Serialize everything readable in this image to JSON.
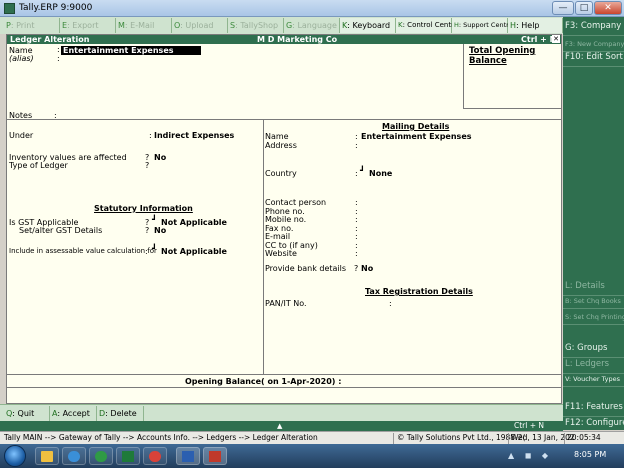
{
  "window": {
    "title": "Tally.ERP 9:9000",
    "minimize": "—",
    "maximize": "□",
    "close": "✕"
  },
  "topbar": [
    {
      "key": "P",
      "label": ": Print",
      "active": false
    },
    {
      "key": "E",
      "label": ": Export",
      "active": false
    },
    {
      "key": "M",
      "label": ": E-Mail",
      "active": false
    },
    {
      "key": "O",
      "label": ": Upload",
      "active": false
    },
    {
      "key": "S",
      "label": ": TallyShop",
      "active": false
    },
    {
      "key": "G",
      "label": ": Language",
      "active": false
    },
    {
      "key": "K",
      "label": ": Keyboard",
      "active": true
    },
    {
      "key": "K",
      "label": ": Control Centre",
      "active": true
    },
    {
      "key": "H",
      "label": ": Support Centre",
      "active": true
    },
    {
      "key": "H",
      "label": ": Help",
      "active": true
    }
  ],
  "rightpanel": [
    {
      "label": "F3: Company",
      "dim": false
    },
    {
      "label": "F3: New Company",
      "dim": true
    },
    {
      "label": "F10: Edit Sort",
      "dim": false
    },
    {
      "label": "L: Details",
      "dim": true
    },
    {
      "label": "B: Set Chq Books",
      "dim": true
    },
    {
      "label": "S: Set Chq Printing",
      "dim": true
    },
    {
      "label": "G: Groups",
      "dim": false
    },
    {
      "label": "L: Ledgers",
      "dim": true
    },
    {
      "label": "V: Voucher Types",
      "dim": false
    },
    {
      "label": "F11: Features",
      "dim": false
    },
    {
      "label": "F12: Configure",
      "dim": false
    }
  ],
  "header": {
    "title": "Ledger Alteration",
    "company": "M D Marketing Co",
    "shortcut": "Ctrl + M",
    "close": "✕"
  },
  "form": {
    "name_label": "Name",
    "name_value": "Entertainment Expenses",
    "alias_label": "(alias)",
    "colon": ":",
    "opening_balance_box": "Total Opening Balance",
    "notes_label": "Notes",
    "under_label": "Under",
    "under_value": "Indirect Expenses",
    "inventory_label": "Inventory values are affected",
    "inventory_value": "No",
    "type_label": "Type of Ledger",
    "type_value": "",
    "qmark": "?",
    "statutory_title": "Statutory Information",
    "gst_label": "Is GST Applicable",
    "gst_value": "Not Applicable",
    "gst_details_label": "Set/alter GST Details",
    "gst_details_value": "No",
    "assessable_label": "Include in assessable value calculation for",
    "assessable_value": "Not Applicable",
    "mark": "┛"
  },
  "mailing": {
    "title": "Mailing Details",
    "name_label": "Name",
    "name_value": "Entertainment Expenses",
    "address_label": "Address",
    "country_label": "Country",
    "country_value": "None",
    "contact_label": "Contact person",
    "phone_label": "Phone no.",
    "mobile_label": "Mobile no.",
    "fax_label": "Fax no.",
    "email_label": "E-mail",
    "cc_label": "CC to (if any)",
    "website_label": "Website",
    "bank_label": "Provide bank details",
    "bank_value": "No",
    "tax_title": "Tax Registration Details",
    "pan_label": "PAN/IT No."
  },
  "opening_balance": {
    "label": "Opening Balance",
    "date": "( on 1-Apr-2020) :"
  },
  "bottombar": [
    {
      "key": "Q",
      "label": ": Quit"
    },
    {
      "key": "A",
      "label": ": Accept"
    },
    {
      "key": "D",
      "label": ": Delete"
    }
  ],
  "ctrlbar": {
    "arrow": "▲",
    "shortcut": "Ctrl + N"
  },
  "statusbar": {
    "breadcrumb": "Tally MAIN --> Gateway of Tally --> Accounts Info. --> Ledgers --> Ledger Alteration",
    "copyright": "© Tally Solutions Pvt Ltd., 1988-2(",
    "date": "Wed, 13 Jan, 202",
    "time": "20:05:34"
  },
  "taskbar": {
    "clock": "8:05 PM"
  },
  "colors": {
    "tally_green": "#2f6f4f",
    "button_bar": "#cfe3cf",
    "form_bg": "#fffff0"
  }
}
